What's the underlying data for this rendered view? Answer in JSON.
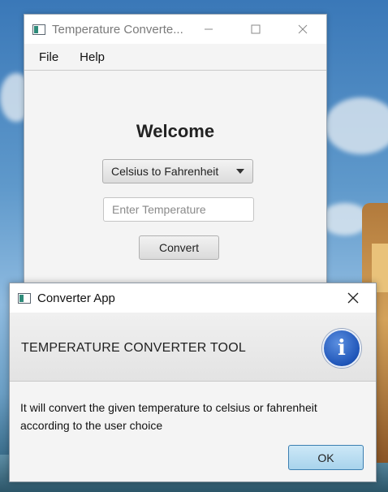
{
  "main_window": {
    "title": "Temperature Converte...",
    "menu": [
      {
        "label": "File"
      },
      {
        "label": "Help"
      }
    ],
    "welcome": "Welcome",
    "conversion_select": {
      "value": "Celsius to Fahrenheit"
    },
    "temperature_input": {
      "value": "",
      "placeholder": "Enter Temperature"
    },
    "convert_label": "Convert"
  },
  "dialog": {
    "title": "Converter App",
    "header": "TEMPERATURE CONVERTER TOOL",
    "message": "It  will convert the given temperature to celsius or fahrenheit\naccording to the user choice",
    "ok_label": "OK"
  },
  "icons": {
    "app": "app-window-icon",
    "info": "info-icon"
  },
  "colors": {
    "ok_button_border": "#3c7fb1",
    "info_icon": "#1f55b8"
  }
}
